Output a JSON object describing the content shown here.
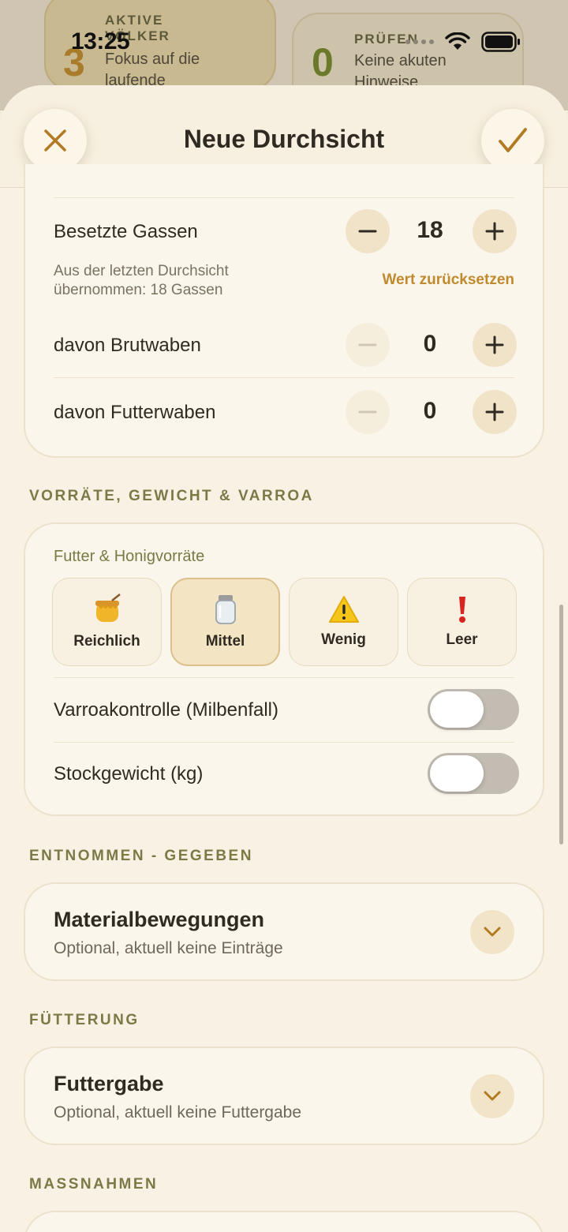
{
  "status_bar": {
    "time": "13:25"
  },
  "background_cards": [
    {
      "number": "3",
      "label": "AKTIVE VÖLKER",
      "text": "Fokus auf die laufende"
    },
    {
      "number": "0",
      "label": "PRÜFEN",
      "text": "Keine akuten Hinweise"
    }
  ],
  "header": {
    "title": "Neue Durchsicht",
    "close_icon": "close-icon",
    "confirm_icon": "checkmark-icon"
  },
  "frames": {
    "occupied": {
      "label": "Besetzte Gassen",
      "value": "18"
    },
    "hint": "Aus der letzten Durchsicht übernommen: 18 Gassen",
    "reset": "Wert zurücksetzen",
    "brood": {
      "label": "davon Brutwaben",
      "value": "0"
    },
    "food": {
      "label": "davon Futterwaben",
      "value": "0"
    }
  },
  "stores_section": {
    "title": "VORRÄTE, GEWICHT & VARROA",
    "stores_label": "Futter & Honigvorräte",
    "options": [
      {
        "label": "Reichlich",
        "icon": "honey-pot-icon",
        "selected": false
      },
      {
        "label": "Mittel",
        "icon": "jar-icon",
        "selected": true
      },
      {
        "label": "Wenig",
        "icon": "warning-icon",
        "selected": false
      },
      {
        "label": "Leer",
        "icon": "exclamation-icon",
        "selected": false
      }
    ],
    "varroa": {
      "label": "Varroakontrolle (Milbenfall)",
      "on": false
    },
    "weight": {
      "label": "Stockgewicht (kg)",
      "on": false
    }
  },
  "material_section": {
    "title": "ENTNOMMEN - GEGEBEN",
    "card_title": "Materialbewegungen",
    "card_sub": "Optional, aktuell keine Einträge"
  },
  "feeding_section": {
    "title": "FÜTTERUNG",
    "card_title": "Futtergabe",
    "card_sub": "Optional, aktuell keine Futtergabe"
  },
  "measures_section": {
    "title": "MASSNAHMEN"
  },
  "colors": {
    "accent": "#c08a2e",
    "section": "#7b7a46",
    "background": "#f8f1e4"
  }
}
